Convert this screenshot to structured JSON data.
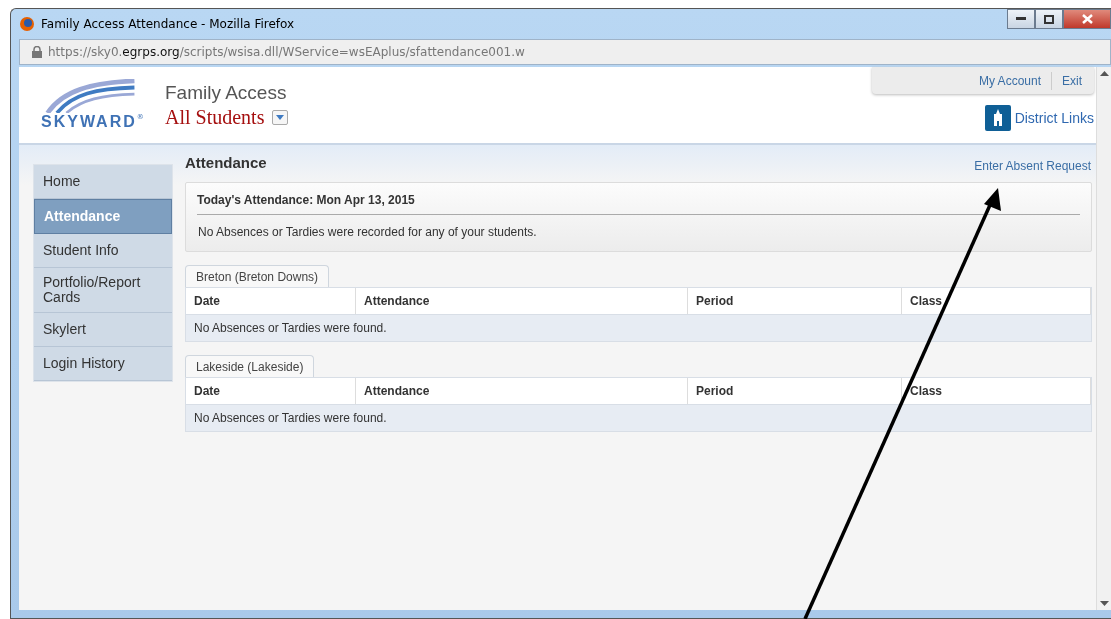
{
  "window": {
    "title": "Family Access Attendance - Mozilla Firefox"
  },
  "address_bar": {
    "url": "https://sky0.**egrps.org**/scripts/wsisa.dll/WService=wsEAplus/sfattendance001.w"
  },
  "header": {
    "logo_text": "SKYWARD",
    "logo_mark": "®",
    "product": "Family Access",
    "student_selector": "All Students",
    "top_links": [
      "My Account",
      "Exit"
    ],
    "district_links": "District Links"
  },
  "sidebar": {
    "items": [
      {
        "label": "Home",
        "selected": false
      },
      {
        "label": "Attendance",
        "selected": true
      },
      {
        "label": "Student Info",
        "selected": false
      },
      {
        "label": "Portfolio/Report Cards",
        "selected": false
      },
      {
        "label": "Skylert",
        "selected": false
      },
      {
        "label": "Login History",
        "selected": false
      }
    ]
  },
  "main": {
    "title": "Attendance",
    "action_link": "Enter Absent Request",
    "today": {
      "title": "Today's Attendance: Mon Apr 13, 2015",
      "message": "No Absences or Tardies were recorded for any of your students."
    },
    "schools": [
      {
        "tab": "Breton (Breton Downs)",
        "columns": [
          "Date",
          "Attendance",
          "Period",
          "Class"
        ],
        "empty_message": "No Absences or Tardies were found."
      },
      {
        "tab": "Lakeside (Lakeside)",
        "columns": [
          "Date",
          "Attendance",
          "Period",
          "Class"
        ],
        "empty_message": "No Absences or Tardies were found."
      }
    ]
  }
}
